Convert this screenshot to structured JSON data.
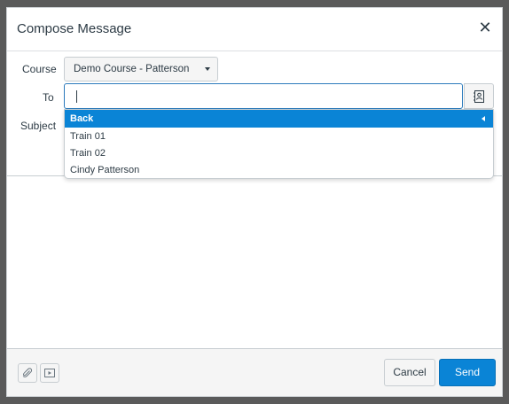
{
  "dialog": {
    "title": "Compose Message",
    "close_icon": "close-icon"
  },
  "form": {
    "course_label": "Course",
    "course_value": "Demo Course - Patterson",
    "to_label": "To",
    "to_value": "",
    "subject_label": "Subject",
    "subject_value": ""
  },
  "recipients_dropdown": {
    "back_label": "Back",
    "items": [
      "Train 01",
      "Train 02",
      "Cindy Patterson"
    ]
  },
  "footer": {
    "attach_icon": "paperclip-icon",
    "media_icon": "media-icon",
    "cancel_label": "Cancel",
    "send_label": "Send"
  },
  "colors": {
    "accent": "#0a84d6",
    "text": "#2d3b45"
  }
}
